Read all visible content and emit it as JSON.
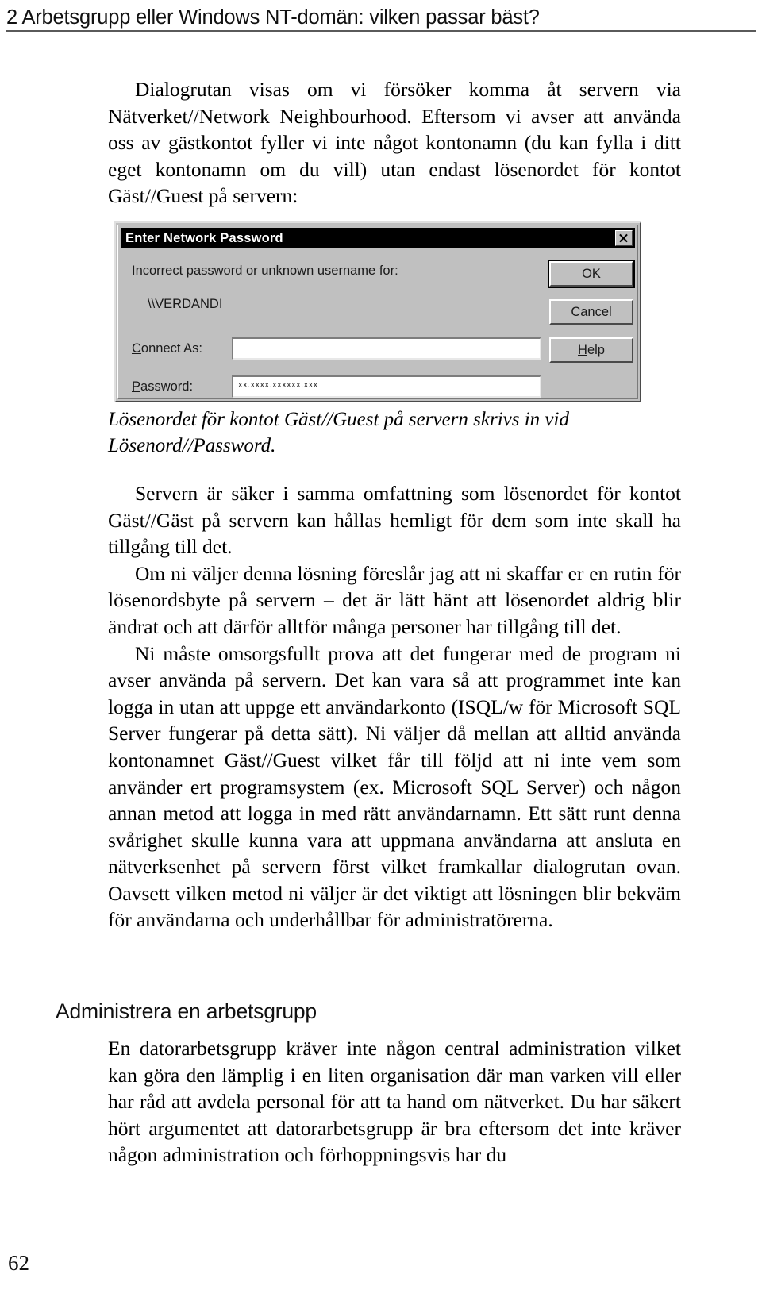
{
  "header": {
    "text": "2  Arbetsgrupp eller Windows NT-domän: vilken passar bäst?"
  },
  "folio": {
    "page_number": "62"
  },
  "body": {
    "paragraph_1": "Dialogrutan visas om vi försöker komma åt servern via Nätverket//Network Neighbourhood. Eftersom vi avser att använda oss av gästkontot fyller vi inte något kontonamn (du kan fylla i ditt eget kontonamn om du vill) utan endast lösenordet för kontot Gäst//Guest på servern:",
    "caption": "Lösenordet för kontot Gäst//Guest på servern skrivs in vid Lösenord//Password.",
    "paragraph_2": "Servern är säker i samma omfattning som lösenordet för kontot Gäst//Gäst på servern kan hållas hemligt för dem som inte skall ha tillgång till det.",
    "paragraph_3": "Om ni väljer denna lösning föreslår jag att ni skaffar er en rutin för lösenordsbyte på servern – det är lätt hänt att lösenordet aldrig blir ändrat och att därför alltför många personer har tillgång till det.",
    "paragraph_4": "Ni måste omsorgsfullt prova att det fungerar med de program ni avser använda på servern. Det kan vara så att programmet inte kan logga in utan att uppge ett användarkonto (ISQL/w för Microsoft SQL Server fungerar på detta sätt). Ni väljer då mellan att alltid använda kontonamnet Gäst//Guest vilket får till följd att ni inte vem som använder ert programsystem (ex. Microsoft SQL Server) och någon annan metod att logga in med rätt användarnamn. Ett sätt runt denna svårighet skulle kunna vara att uppmana användarna att ansluta en nätverksenhet på servern först vilket framkallar dialogrutan ovan. Oavsett vilken metod ni väljer är det viktigt att lösningen blir bekväm för användarna och underhållbar för administratörerna.",
    "section_heading": "Administrera en arbetsgrupp",
    "paragraph_5": "En datorarbetsgrupp kräver inte någon central administration vilket kan göra den lämplig i en liten organisation där man varken vill eller har råd att avdela personal för att ta hand om nätverket. Du har säkert hört argumentet att datorarbetsgrupp är bra eftersom det inte kräver någon administration och förhoppningsvis har du"
  },
  "dialog": {
    "title": "Enter Network Password",
    "close_icon": "close-icon",
    "message": "Incorrect password or unknown username for:",
    "server": "\\\\VERDANDI",
    "fields": [
      {
        "label_prefix": "C",
        "label_rest": "onnect As:",
        "value": ""
      },
      {
        "label_prefix": "P",
        "label_rest": "assword:",
        "value": "••••••••••••••"
      }
    ],
    "connect_as_label_prefix": "C",
    "connect_as_label_rest": "onnect As:",
    "connect_as_value": "",
    "password_label_prefix": "P",
    "password_label_rest": "assword:",
    "password_value": "xx.xxxx.xxxxxx.xxx",
    "buttons": {
      "ok": "OK",
      "cancel": "Cancel",
      "help_prefix": "H",
      "help_rest": "elp"
    }
  },
  "colors": {
    "dialog_face": "#c0c0c0",
    "titlebar": "#000000",
    "rule": "#5a5a5a",
    "text": "#000000"
  }
}
